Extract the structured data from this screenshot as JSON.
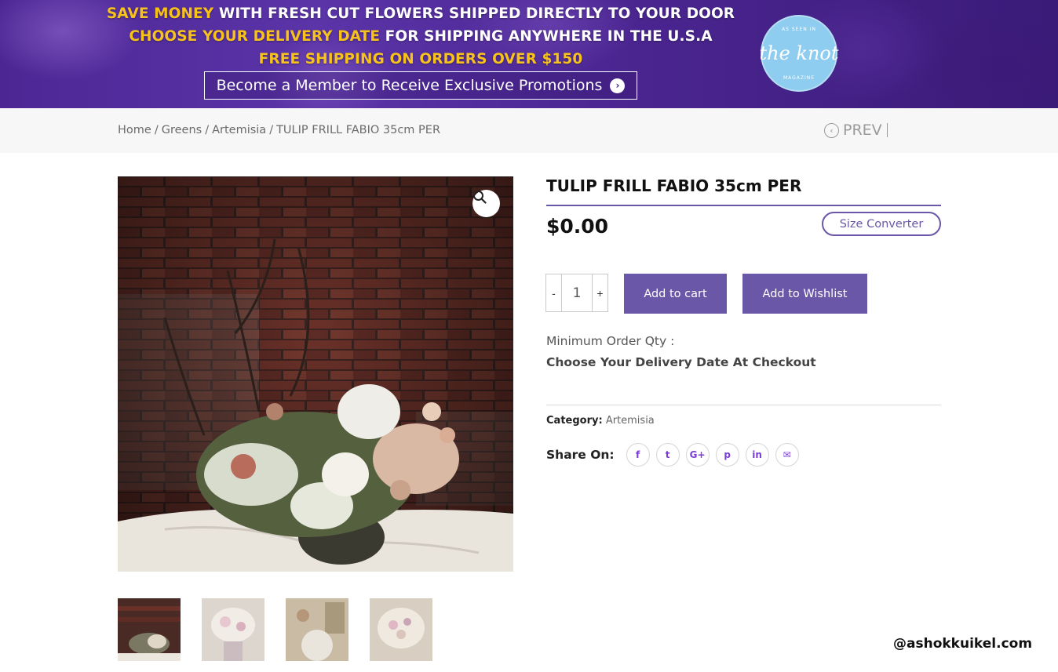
{
  "banner": {
    "line1_highlight": "SAVE MONEY",
    "line1_rest": " WITH FRESH CUT FLOWERS SHIPPED DIRECTLY TO YOUR DOOR",
    "line2_highlight": "CHOOSE YOUR DELIVERY DATE",
    "line2_rest": " FOR SHIPPING ANYWHERE IN THE U.S.A",
    "line3": "FREE SHIPPING ON ORDERS OVER $150",
    "member_button": "Become a Member to Receive Exclusive Promotions",
    "badge": {
      "top": "AS SEEN IN",
      "logo": "the knot",
      "bottom": "MAGAZINE"
    },
    "colors": {
      "highlight": "#f6c21b",
      "background": "#4c2794"
    }
  },
  "breadcrumb": {
    "items": [
      "Home",
      "Greens",
      "Artemisia",
      "TULIP FRILL FABIO 35cm PER"
    ],
    "separator": "/",
    "prev_label": "PREV"
  },
  "product": {
    "title": "TULIP FRILL FABIO 35cm PER",
    "price": "$0.00",
    "size_converter": "Size Converter",
    "quantity": {
      "value": "1",
      "minus": "-",
      "plus": "+"
    },
    "add_to_cart": "Add to cart",
    "add_to_wishlist": "Add to Wishlist",
    "min_order_label": "Minimum Order Qty :",
    "delivery_note": "Choose Your Delivery Date At Checkout",
    "category_label": "Category:",
    "category_value": "Artemisia",
    "share_label": "Share On:",
    "share_icons": [
      {
        "name": "facebook-icon",
        "glyph": "f"
      },
      {
        "name": "twitter-icon",
        "glyph": "t"
      },
      {
        "name": "google-plus-icon",
        "glyph": "G+"
      },
      {
        "name": "pinterest-icon",
        "glyph": "p"
      },
      {
        "name": "linkedin-icon",
        "glyph": "in"
      },
      {
        "name": "email-icon",
        "glyph": "✉"
      }
    ],
    "accent_color": "#6b57a8",
    "share_icon_color": "#7b3fd4"
  },
  "gallery": {
    "thumbnails": [
      "thumb-1",
      "thumb-2",
      "thumb-3",
      "thumb-4"
    ]
  },
  "watermark": "@ashokkuikel.com"
}
